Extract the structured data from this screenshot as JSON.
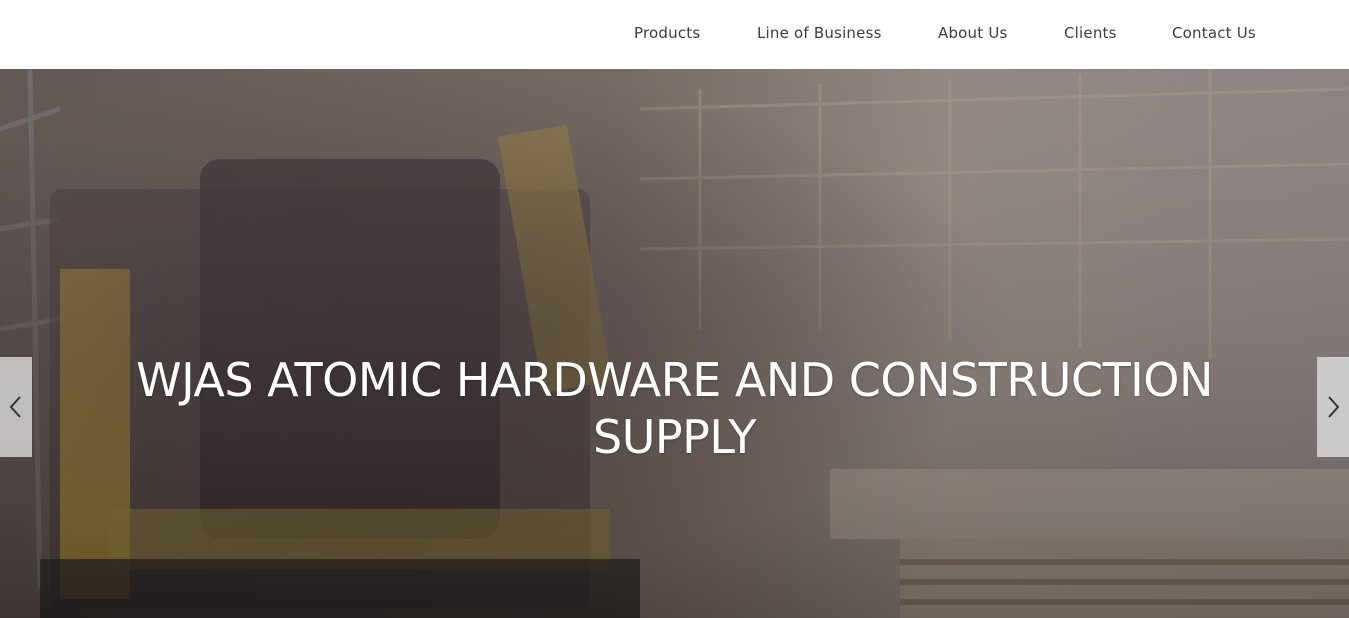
{
  "nav": {
    "items": [
      {
        "label": "Products"
      },
      {
        "label": "Line of Business"
      },
      {
        "label": "About Us"
      },
      {
        "label": "Clients"
      },
      {
        "label": "Contact Us"
      }
    ]
  },
  "hero": {
    "title_line1": "WJAS ATOMIC HARDWARE AND CONSTRUCTION",
    "title_line2": "SUPPLY",
    "prev_icon": "chevron-left-icon",
    "next_icon": "chevron-right-icon"
  },
  "colors": {
    "nav_text": "#3d3d3d",
    "hero_text": "#ffffff",
    "arrow_bg": "#ebebeb"
  }
}
